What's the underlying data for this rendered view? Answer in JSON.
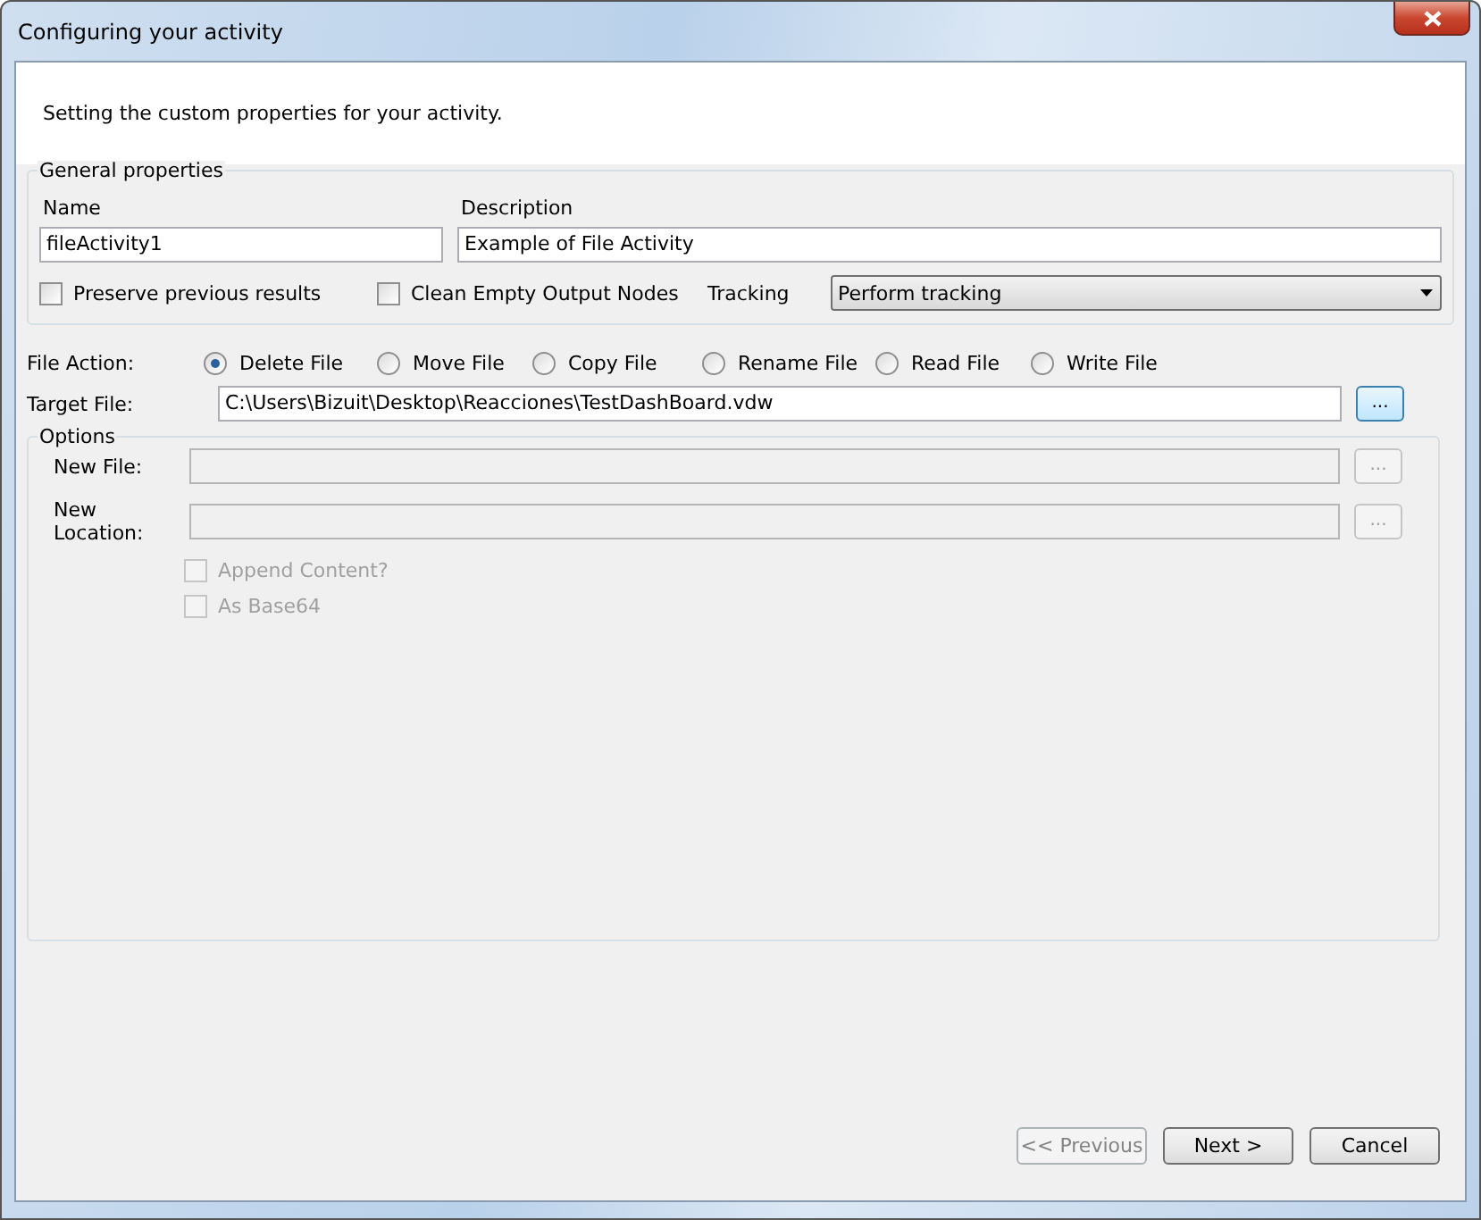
{
  "window": {
    "title": "Configuring your activity"
  },
  "header": {
    "text": "Setting the custom properties for your activity."
  },
  "general": {
    "legend": "General properties",
    "fields": [
      {
        "label": "Name",
        "value": "fileActivity1"
      },
      {
        "label": "Description",
        "value": "Example of File Activity"
      }
    ],
    "checkboxes": [
      {
        "label": "Preserve previous results",
        "checked": false
      },
      {
        "label": "Clean Empty Output Nodes",
        "checked": false
      }
    ],
    "tracking": {
      "label": "Tracking",
      "value": "Perform tracking"
    }
  },
  "file_action": {
    "label": "File Action:",
    "options": [
      {
        "label": "Delete File",
        "selected": true
      },
      {
        "label": "Move File",
        "selected": false
      },
      {
        "label": "Copy File",
        "selected": false
      },
      {
        "label": "Rename File",
        "selected": false
      },
      {
        "label": "Read File",
        "selected": false
      },
      {
        "label": "Write File",
        "selected": false
      }
    ]
  },
  "target_file": {
    "label": "Target File:",
    "value": "C:\\Users\\Bizuit\\Desktop\\Reacciones\\TestDashBoard.vdw",
    "button": "...",
    "disabled": false
  },
  "options": {
    "legend": "Options",
    "fields": [
      {
        "label": "New File:",
        "button": "...",
        "disabled": true
      },
      {
        "label": "New Location:",
        "button": "...",
        "disabled": true
      }
    ],
    "checkboxes": [
      {
        "label": "Append Content?",
        "checked": false,
        "disabled": true
      },
      {
        "label": "As Base64",
        "checked": false,
        "disabled": true
      }
    ]
  },
  "buttons": [
    {
      "label": "<< Previous",
      "disabled": true
    },
    {
      "label": "Next >",
      "disabled": false
    },
    {
      "label": "Cancel",
      "disabled": false
    }
  ]
}
